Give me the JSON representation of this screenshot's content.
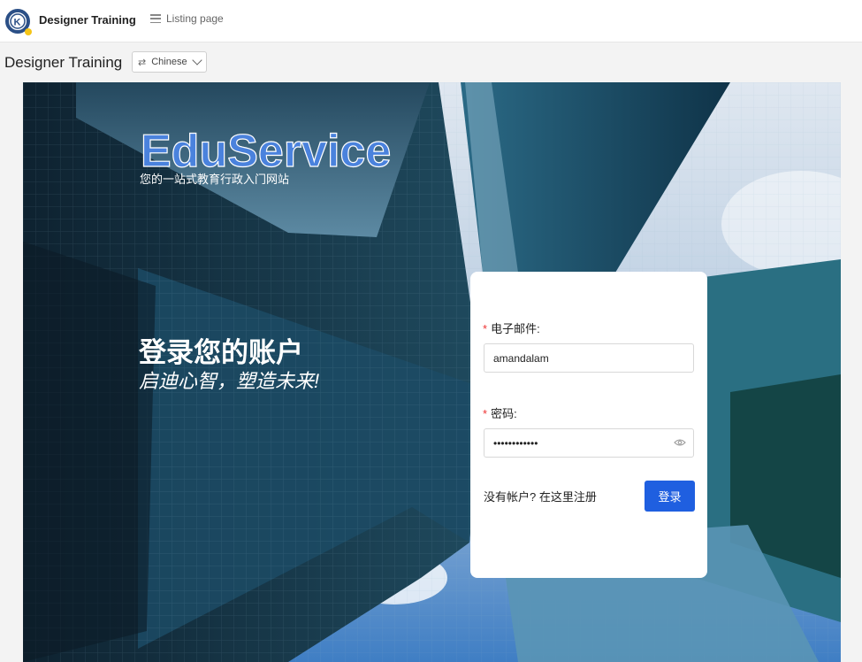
{
  "app": {
    "brand": "Designer Training",
    "nav_link": "Listing page",
    "page_title": "Designer Training",
    "language": "Chinese"
  },
  "hero": {
    "brand_name": "EduService",
    "tagline": "您的一站式教育行政入门网站",
    "heading": "登录您的账户",
    "subheading": "启迪心智，塑造未来!"
  },
  "login": {
    "email_label": "电子邮件:",
    "email_value": "amandalam",
    "password_label": "密码:",
    "password_value": "••••••••••••",
    "register_text": "没有帐户? 在这里注册",
    "submit_label": "登录"
  },
  "colors": {
    "accent": "#1f5fe0",
    "brand_blue": "#4a82dd",
    "required": "#e33333"
  },
  "icons": [
    "app-logo-icon",
    "list-icon",
    "swap-icon",
    "chevron-down-icon",
    "eye-icon"
  ]
}
